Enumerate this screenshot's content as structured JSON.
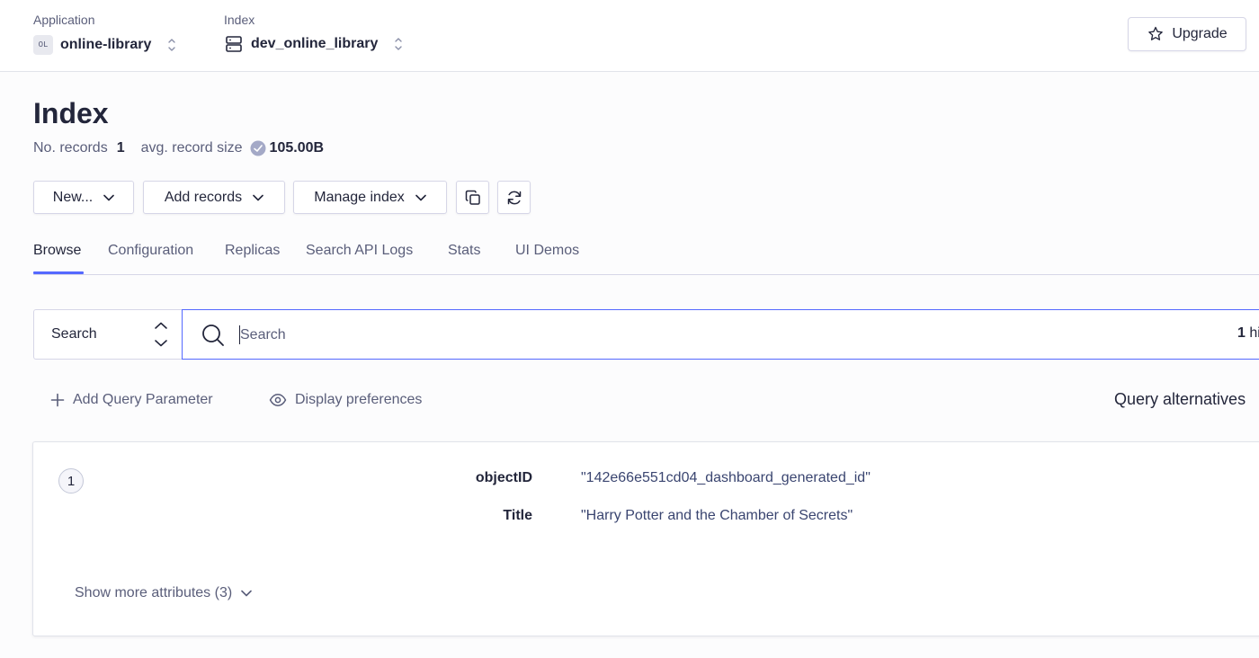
{
  "header": {
    "application": {
      "label": "Application",
      "badge": "OL",
      "value": "online-library"
    },
    "index": {
      "label": "Index",
      "value": "dev_online_library"
    },
    "upgrade_label": "Upgrade"
  },
  "page": {
    "title": "Index",
    "records_label": "No. records",
    "records_value": "1",
    "size_label": "avg. record size",
    "size_value": "105.00B"
  },
  "toolbar": {
    "new_label": "New...",
    "add_records_label": "Add records",
    "manage_index_label": "Manage index"
  },
  "tabs": [
    {
      "label": "Browse",
      "active": true
    },
    {
      "label": "Configuration"
    },
    {
      "label": "Replicas"
    },
    {
      "label": "Search API Logs"
    },
    {
      "label": "Stats"
    },
    {
      "label": "UI Demos"
    }
  ],
  "search": {
    "type_value": "Search",
    "placeholder": "Search",
    "value": "",
    "hits_count": "1",
    "hits_suffix": "hi"
  },
  "actions": {
    "add_param_label": "Add Query Parameter",
    "display_prefs_label": "Display preferences",
    "query_alternatives_label": "Query alternatives"
  },
  "record": {
    "number": "1",
    "attributes": [
      {
        "key": "objectID",
        "value": "\"142e66e551cd04_dashboard_generated_id\""
      },
      {
        "key": "Title",
        "value": "\"Harry Potter and the Chamber of Secrets\""
      }
    ],
    "show_more_label": "Show more attributes (3)"
  },
  "colors": {
    "accent": "#5468ff",
    "text": "#23263b",
    "muted": "#5a5e7a",
    "border": "#d6d6e7"
  }
}
